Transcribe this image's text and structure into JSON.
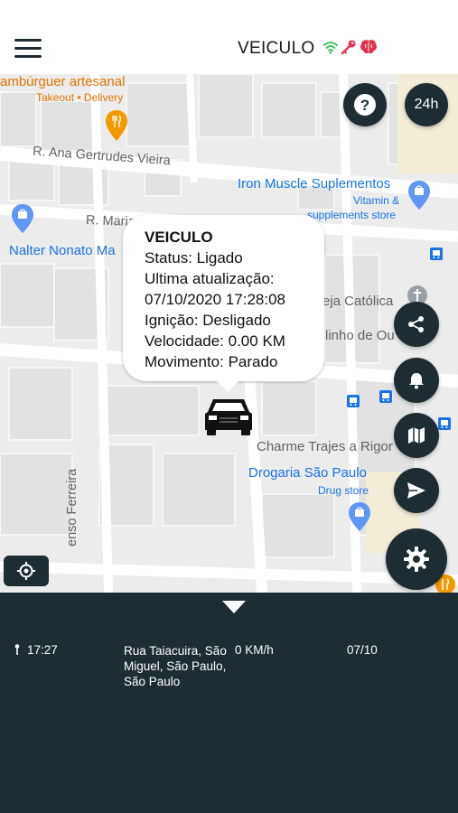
{
  "header": {
    "title": "VEICULO",
    "icons": [
      "wifi-icon",
      "key-icon",
      "brain-icon"
    ],
    "colors": {
      "wifi": "#3fc35a",
      "key": "#e0324b",
      "brain": "#e0324b"
    }
  },
  "map": {
    "labels": {
      "restaurant_name": "ambúrguer artesanal",
      "restaurant_sub": "Takeout • Delivery",
      "street_1": "R. Ana Gertrudes Vieira",
      "street_2": "R. Maria",
      "store_left": "Nalter Nonato Ma",
      "iron_muscle": "Iron Muscle Suplementos",
      "iron_muscle_sub_1": "Vitamin &",
      "iron_muscle_sub_2": "supplements store",
      "church": "eja Católica",
      "place_2": "linho de Ou",
      "charme": "Charme Trajes a Rigor",
      "drogaria": "Drogaria São Paulo",
      "drogaria_sub": "Drug store",
      "street_vertical": "enso Ferreira"
    },
    "buttons": {
      "help": "?",
      "history_24h": "24h"
    }
  },
  "info_bubble": {
    "title": "VEICULO",
    "status": "Status: Ligado",
    "last_update_label": "Ultima atualização:",
    "last_update_value": "07/10/2020 17:28:08",
    "ignition": "Ignição: Desligado",
    "speed": "Velocidade: 0.00 KM",
    "movement": "Movimento: Parado"
  },
  "panel": {
    "rows": [
      {
        "time": "17:27",
        "address": "Rua Taiacuira, São Miguel, São Paulo, São Paulo",
        "speed": "0 KM/h",
        "date": "07/10"
      }
    ]
  }
}
